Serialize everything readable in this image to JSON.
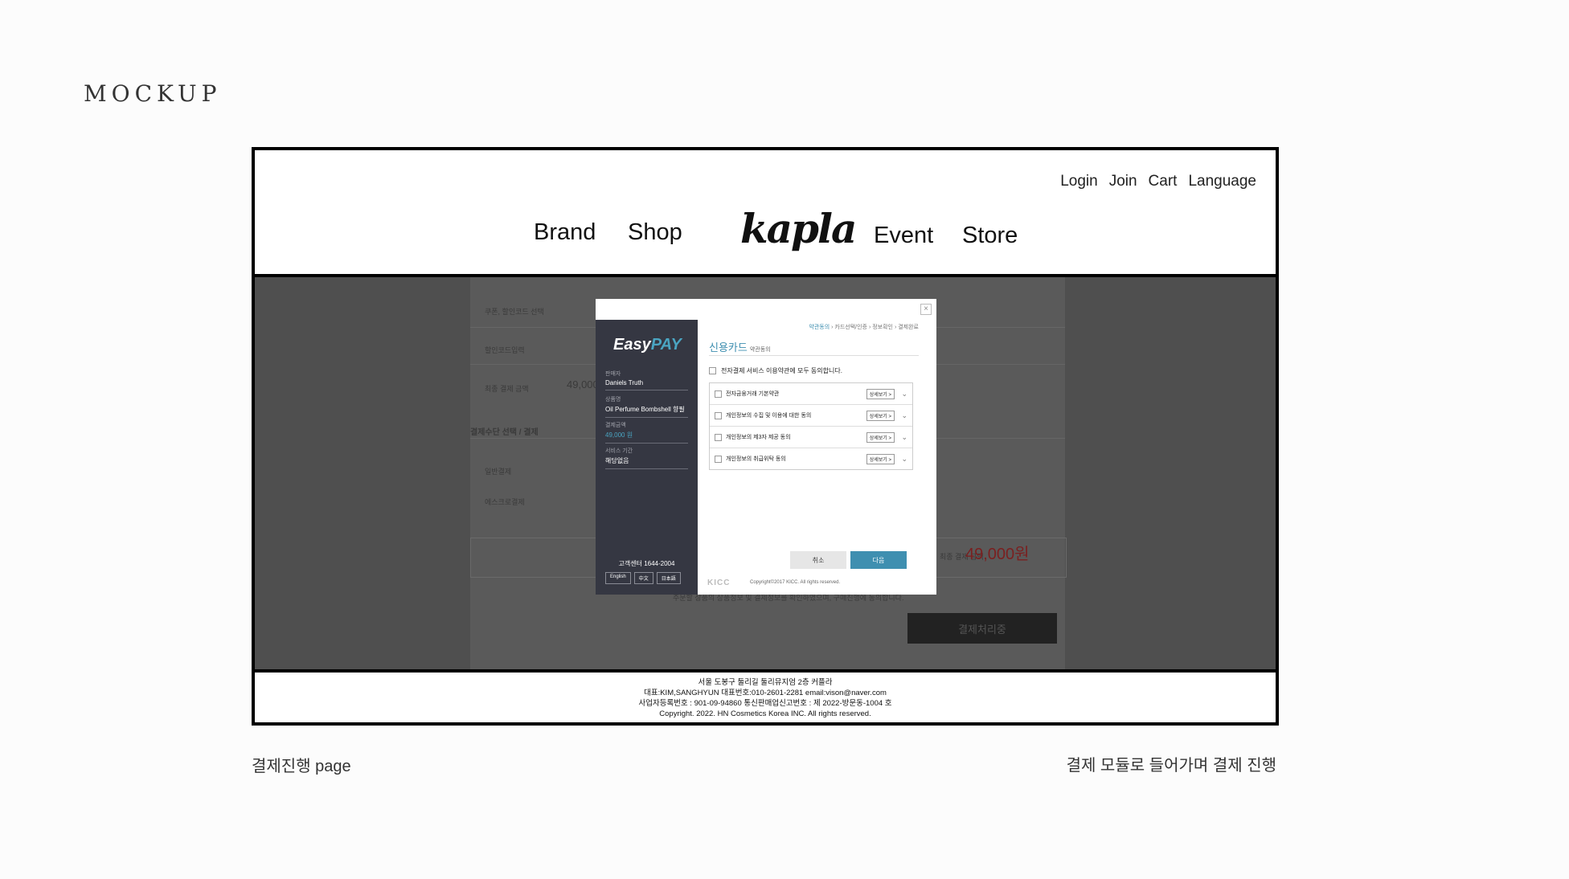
{
  "mockup_title": "MOCKUP",
  "header": {
    "utility": [
      "Login",
      "Join",
      "Cart",
      "Language"
    ],
    "nav_left": [
      "Brand",
      "Shop"
    ],
    "logo": "kapla",
    "nav_right": [
      "Event",
      "Store"
    ]
  },
  "background_page": {
    "rows": [
      "쿠폰, 할인코드 선택",
      "할인코드입력",
      "최종 결제 금액"
    ],
    "price_partial": "49,000",
    "section_title": "결제수단 선택 / 결제",
    "pay_rows": [
      "일반결제",
      "에스크로결제"
    ],
    "total_label": "최종 결제 금액",
    "total_value": "49,000원",
    "agree_text": "주문할 상품의 상품정보 및 결제정보를 확인하였으며, 구매진행에 동의합니다.",
    "submit_label": "결제처리중"
  },
  "modal": {
    "brand_prefix": "Easy",
    "brand_suffix": "PAY",
    "info": [
      {
        "label": "판매자",
        "value": "Daniels Truth"
      },
      {
        "label": "상품명",
        "value": "Oil Perfume Bombshell 향필"
      },
      {
        "label": "결제금액",
        "value": "49,000 원"
      },
      {
        "label": "서비스 기간",
        "value": "해당없음"
      }
    ],
    "service_center": "고객센터 1644-2004",
    "langs": [
      "English",
      "中文",
      "日本語"
    ],
    "steps": [
      "약관동의",
      "카드선택/인증",
      "정보확인",
      "결제완료"
    ],
    "title": "신용카드",
    "subtitle": "약관동의",
    "agree_all": "전자결제 서비스 이용약관에 모두 동의합니다.",
    "terms": [
      "전자금융거래 기본약관",
      "개인정보의 수집 및 이용에 대한 동의",
      "개인정보의 제3자 제공 동의",
      "개인정보의 취급위탁 동의"
    ],
    "detail_label": "상세보기 >",
    "cancel_label": "취소",
    "next_label": "다음",
    "kicc": "KICC",
    "copyright": "Copyright©2017 KICC. All rights reserved."
  },
  "footer": {
    "lines": [
      "서울 도봉구 둘리길 둘리뮤지엄 2층 커플라",
      "대표:KIM,SANGHYUN  대표번호:010-2601-2281 email:vison@naver.com",
      "사업자등록번호 : 901-09-94860  통신판매업신고번호 : 제 2022-방문동-1004 호",
      "Copyright. 2022. HN Cosmetics Korea INC. All rights reserved."
    ]
  },
  "captions": {
    "left": "결제진행 page",
    "right": "결제 모듈로 들어가며 결제 진행"
  }
}
